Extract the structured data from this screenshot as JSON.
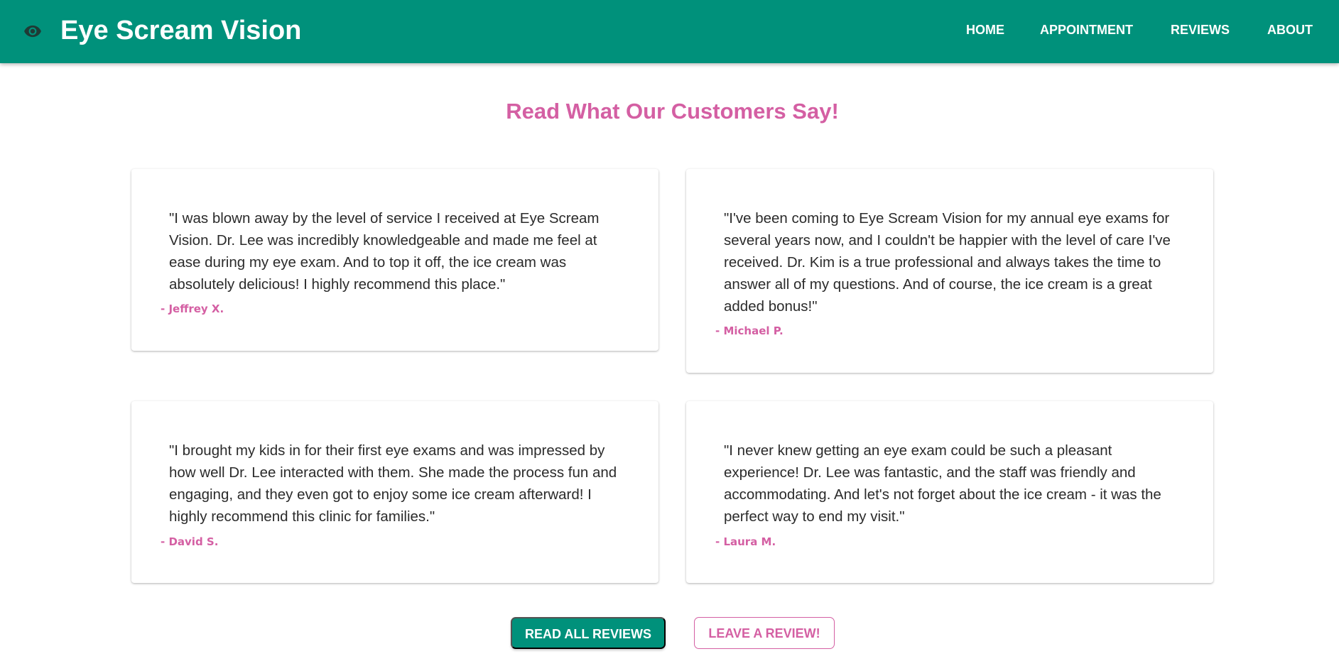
{
  "header": {
    "brand_icon": "eye-icon",
    "title": "Eye Scream Vision",
    "background": "#00917b",
    "nav": [
      {
        "label": "HOME"
      },
      {
        "label": "APPOINTMENT"
      },
      {
        "label": "REVIEWS"
      },
      {
        "label": "ABOUT"
      }
    ]
  },
  "main": {
    "heading": "Read What Our Customers Say!",
    "accent_color": "#d45fa3",
    "reviews": [
      {
        "quote": "\"I was blown away by the level of service I received at Eye Scream Vision. Dr. Lee was incredibly knowledgeable and made me feel at ease during my eye exam. And to top it off, the ice cream was absolutely delicious! I highly recommend this place.\"",
        "author": "- Jeffrey X."
      },
      {
        "quote": "\"I've been coming to Eye Scream Vision for my annual eye exams for several years now, and I couldn't be happier with the level of care I've received. Dr. Kim is a true professional and always takes the time to answer all of my questions. And of course, the ice cream is a great added bonus!\"",
        "author": "- Michael P."
      },
      {
        "quote": "\"I brought my kids in for their first eye exams and was impressed by how well Dr. Lee interacted with them. She made the process fun and engaging, and they even got to enjoy some ice cream afterward! I highly recommend this clinic for families.\"",
        "author": "- David S."
      },
      {
        "quote": "\"I never knew getting an eye exam could be such a pleasant experience! Dr. Lee was fantastic, and the staff was friendly and accommodating. And let's not forget about the ice cream - it was the perfect way to end my visit.\"",
        "author": "- Laura M."
      }
    ],
    "buttons": {
      "read_all": "READ ALL REVIEWS",
      "leave_review": "LEAVE A REVIEW!"
    }
  }
}
